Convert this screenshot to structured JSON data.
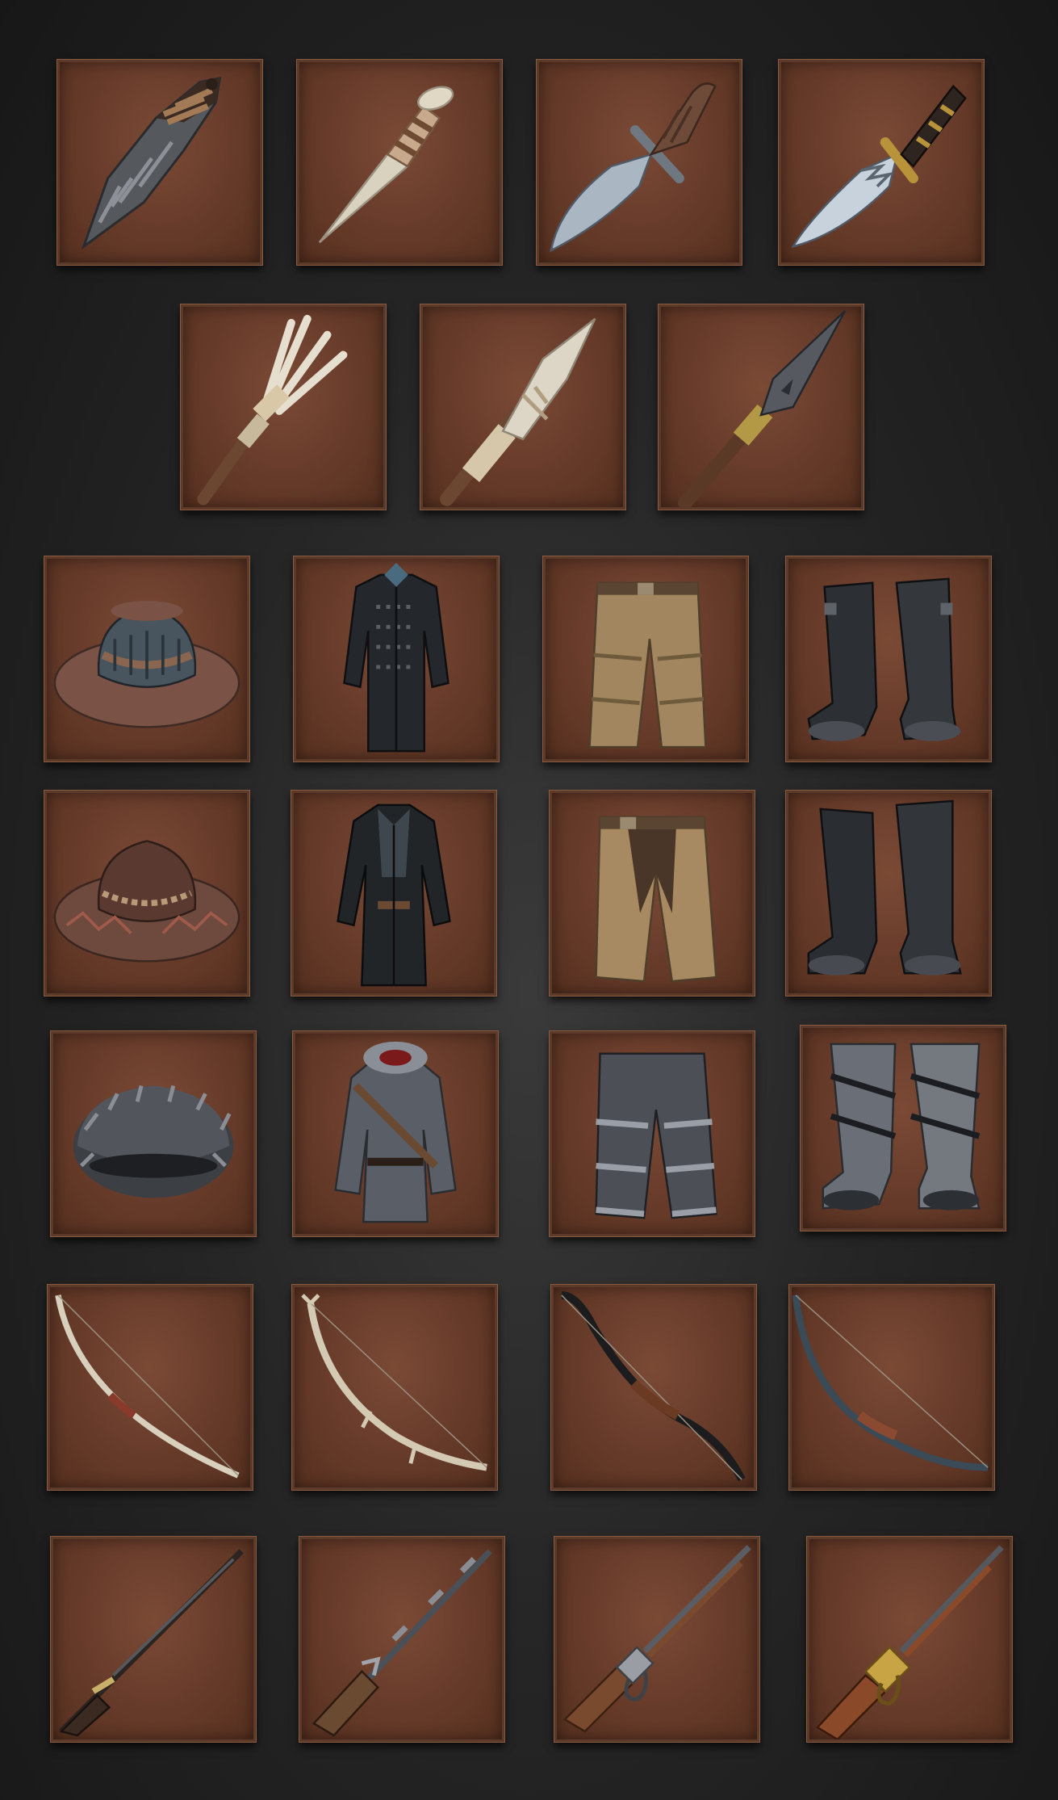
{
  "inventory": {
    "rows": [
      {
        "category": "knives",
        "items": [
          {
            "icon": "stone-knife-icon"
          },
          {
            "icon": "bone-dagger-icon"
          },
          {
            "icon": "antler-hunting-knife-icon"
          },
          {
            "icon": "bowie-knife-icon"
          }
        ]
      },
      {
        "category": "spears",
        "items": [
          {
            "icon": "bone-fishing-spear-icon"
          },
          {
            "icon": "bone-spear-icon"
          },
          {
            "icon": "iron-spear-icon"
          }
        ]
      },
      {
        "category": "leather-armor",
        "items": [
          {
            "icon": "studded-leather-hat-icon"
          },
          {
            "icon": "studded-leather-coat-icon"
          },
          {
            "icon": "patched-leather-pants-icon"
          },
          {
            "icon": "leather-boots-icon"
          }
        ]
      },
      {
        "category": "cowboy-outfit",
        "items": [
          {
            "icon": "suede-cowboy-hat-icon"
          },
          {
            "icon": "black-leather-duster-icon"
          },
          {
            "icon": "leather-chaps-icon"
          },
          {
            "icon": "riding-boots-icon"
          }
        ]
      },
      {
        "category": "fur-outfit",
        "items": [
          {
            "icon": "fur-hat-icon"
          },
          {
            "icon": "fur-parka-icon"
          },
          {
            "icon": "fur-pants-icon"
          },
          {
            "icon": "fur-boots-icon"
          }
        ]
      },
      {
        "category": "bows",
        "items": [
          {
            "icon": "bone-bow-icon"
          },
          {
            "icon": "antler-bow-icon"
          },
          {
            "icon": "recurve-bow-icon"
          },
          {
            "icon": "hunting-bow-icon"
          }
        ]
      },
      {
        "category": "rifles",
        "items": [
          {
            "icon": "flintlock-rifle-icon"
          },
          {
            "icon": "musket-icon"
          },
          {
            "icon": "lever-action-rifle-icon"
          },
          {
            "icon": "brass-lever-rifle-icon"
          }
        ]
      }
    ]
  },
  "colors": {
    "background": "#1f1f1f",
    "slot_fill": "#6a3d2c",
    "slot_border": "#5b3a2a"
  }
}
